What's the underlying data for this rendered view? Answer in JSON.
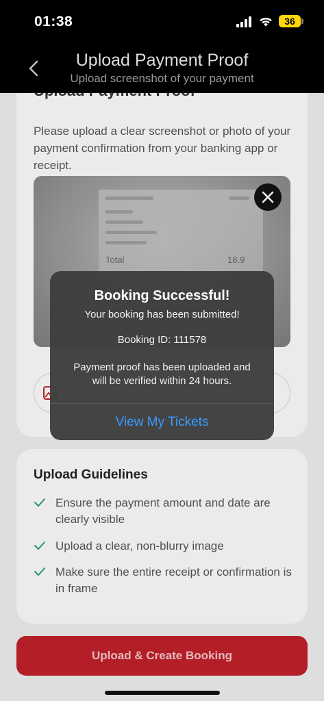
{
  "status_bar": {
    "time": "01:38",
    "battery": "36"
  },
  "header": {
    "title": "Upload Payment Proof",
    "subtitle": "Upload screenshot of your payment"
  },
  "upload_card": {
    "section_title": "Upload Payment Proof",
    "description": "Please upload a clear screenshot or photo of your payment confirmation from your banking app or receipt."
  },
  "preview": {
    "total_label": "Total",
    "total_value": "18.9"
  },
  "guidelines": {
    "title": "Upload Guidelines",
    "items": [
      "Ensure the payment amount and date are clearly visible",
      "Upload a clear, non-blurry image",
      "Make sure the entire receipt or confirmation is in frame"
    ]
  },
  "primary_button": {
    "label": "Upload & Create Booking"
  },
  "alert": {
    "title": "Booking Successful!",
    "line1": "Your booking has been submitted!",
    "booking_id": "Booking ID: 111578",
    "line3a": "Payment proof has been uploaded and",
    "line3b": "will be verified within 24 hours.",
    "action": "View My Tickets"
  },
  "colors": {
    "accent": "#c0202a",
    "link": "#3a9bff",
    "check": "#2e9e6e"
  }
}
